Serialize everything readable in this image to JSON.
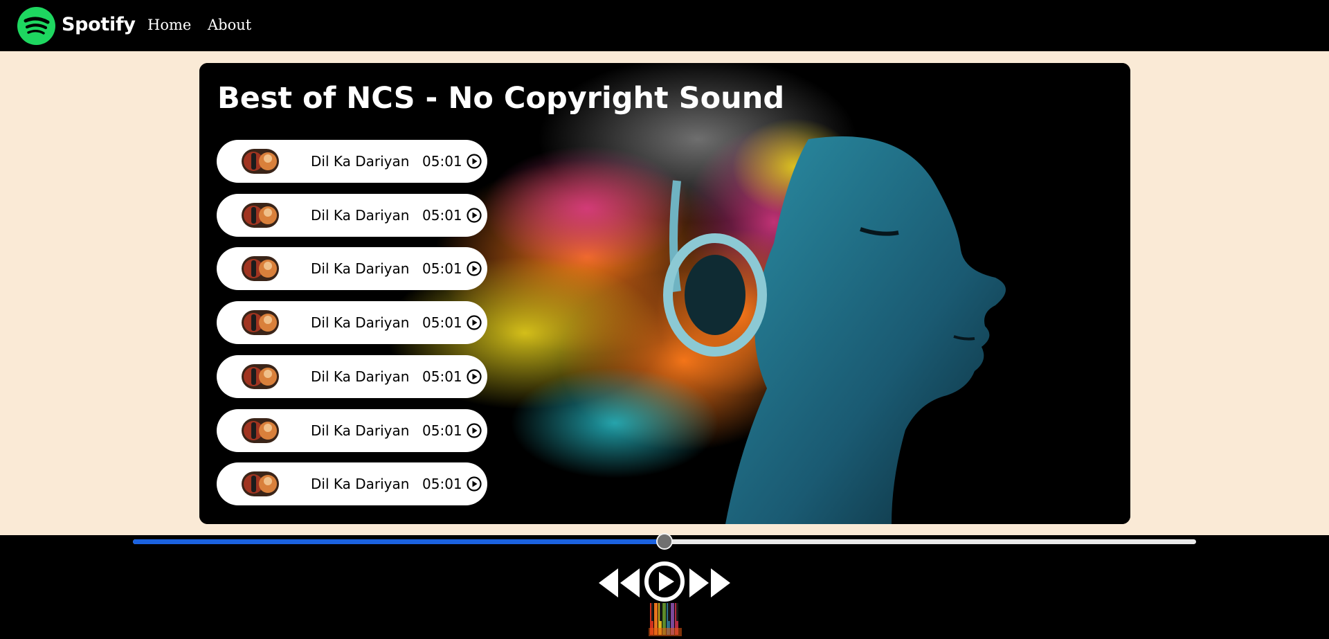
{
  "nav": {
    "brand": "Spotify",
    "links": [
      "Home",
      "About"
    ]
  },
  "playlist": {
    "title": "Best of NCS - No Copyright Sound",
    "songs": [
      {
        "name": "Dil Ka Dariyan",
        "duration": "05:01"
      },
      {
        "name": "Dil Ka Dariyan",
        "duration": "05:01"
      },
      {
        "name": "Dil Ka Dariyan",
        "duration": "05:01"
      },
      {
        "name": "Dil Ka Dariyan",
        "duration": "05:01"
      },
      {
        "name": "Dil Ka Dariyan",
        "duration": "05:01"
      },
      {
        "name": "Dil Ka Dariyan",
        "duration": "05:01"
      },
      {
        "name": "Dil Ka Dariyan",
        "duration": "05:01"
      }
    ]
  },
  "player": {
    "progress_percent": 50,
    "controls": [
      "previous-icon",
      "play-circle-icon",
      "next-icon"
    ]
  },
  "colors": {
    "brand_green": "#1ed760",
    "nav_bg": "#000000",
    "page_bg": "#faead6",
    "progress_fill": "#1b62e0",
    "progress_track": "#ebebeb"
  }
}
